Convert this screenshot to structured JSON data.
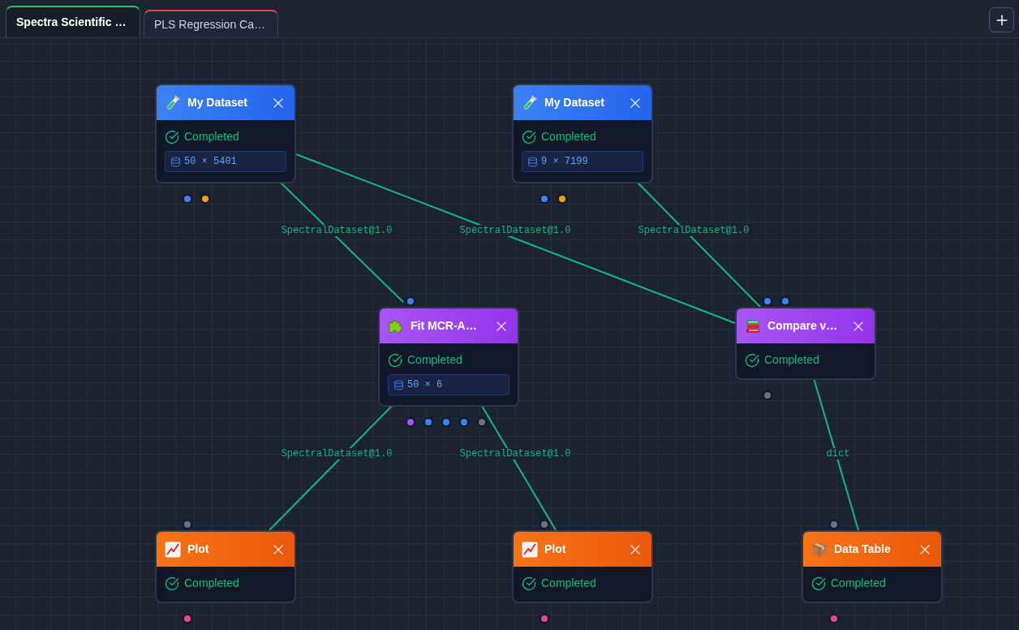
{
  "tabs": [
    {
      "label": "Spectra Scientific …",
      "selected": true,
      "color": "#22c55e"
    },
    {
      "label": "PLS Regression Ca…",
      "selected": false,
      "color": "#ef4444"
    }
  ],
  "canvas": {
    "nodes": [
      {
        "kind": "dataset",
        "title": "My Dataset",
        "status": "Completed",
        "shape": "50 × 5401",
        "outputs": [
          {
            "color": "#3b82f6"
          },
          {
            "color": "#f59e0b"
          }
        ]
      },
      {
        "kind": "dataset",
        "title": "My Dataset",
        "status": "Completed",
        "shape": "9 × 7199",
        "outputs": [
          {
            "color": "#3b82f6"
          },
          {
            "color": "#f59e0b"
          }
        ]
      },
      {
        "kind": "model",
        "title": "Fit MCR-A…",
        "status": "Completed",
        "shape": "50 × 6",
        "inputs": [
          {
            "color": "#3b82f6"
          }
        ],
        "outputs": [
          {
            "color": "#a855f7"
          },
          {
            "color": "#3b82f6"
          },
          {
            "color": "#3b82f6"
          },
          {
            "color": "#3b82f6"
          },
          {
            "color": "#6b7280"
          }
        ]
      },
      {
        "kind": "comparison",
        "title": "Compare v…",
        "status": "Completed",
        "inputs": [
          {
            "color": "#3b82f6"
          },
          {
            "color": "#3b82f6"
          }
        ],
        "outputs": [
          {
            "color": "#6b7280"
          }
        ]
      },
      {
        "kind": "plot",
        "title": "Plot",
        "status": "Completed",
        "inputs": [
          {
            "color": "#6b7280"
          }
        ],
        "outputs": [
          {
            "color": "#ec4899"
          }
        ]
      },
      {
        "kind": "plot",
        "title": "Plot",
        "status": "Completed",
        "inputs": [
          {
            "color": "#6b7280"
          }
        ],
        "outputs": [
          {
            "color": "#ec4899"
          }
        ]
      },
      {
        "kind": "table",
        "title": "Data Table",
        "status": "Completed",
        "inputs": [
          {
            "color": "#6b7280"
          }
        ],
        "outputs": [
          {
            "color": "#ec4899"
          }
        ]
      }
    ],
    "edges": [
      {
        "label": "SpectralDataset@1.0"
      },
      {
        "label": "SpectralDataset@1.0"
      },
      {
        "label": "SpectralDataset@1.0"
      },
      {
        "label": "SpectralDataset@1.0"
      },
      {
        "label": "SpectralDataset@1.0"
      },
      {
        "label": "dict"
      }
    ]
  }
}
